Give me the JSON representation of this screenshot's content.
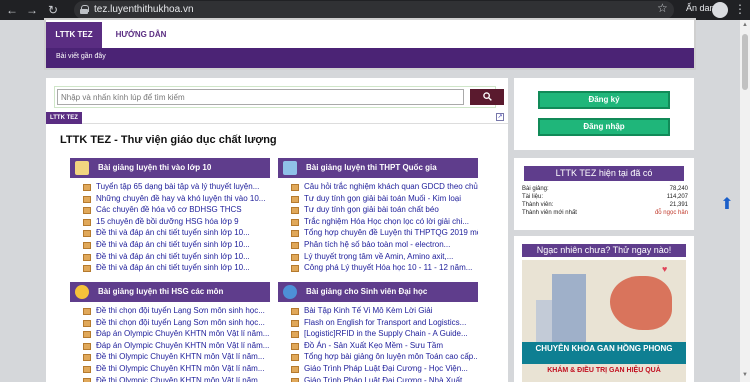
{
  "browser": {
    "url": "tez.luyenthithukhoa.vn",
    "profile_label": "Ẩn danh",
    "icons": [
      "back-icon",
      "forward-icon",
      "reload-icon",
      "lock-icon",
      "star-icon",
      "incognito-icon",
      "menu-icon"
    ]
  },
  "header": {
    "tabs": [
      "LTTK TEZ",
      "HƯỚNG DẪN"
    ],
    "subnav_link": "Bài viết gần đây"
  },
  "search": {
    "placeholder": "Nhập và nhấn kính lúp để tìm kiếm"
  },
  "breadcrumb": "LTTK TEZ",
  "page_title": "LTTK TEZ - Thư viện giáo dục chất lượng",
  "panels": [
    {
      "title": "Bài giảng luyện thi vào lớp 10",
      "items": [
        "Tuyển tập 65 dạng bài tập và lý thuyết luyện...",
        "Những chuyên đề hay và khó luyện thi vào 10...",
        "Các chuyên đề hóa vô cơ BDHSG THCS",
        "15 chuyên đề bồi dưỡng HSG hóa lớp 9",
        "Đề thi và đáp án chi tiết tuyển sinh lớp 10...",
        "Đề thi và đáp án chi tiết tuyển sinh lớp 10...",
        "Đề thi và đáp án chi tiết tuyển sinh lớp 10...",
        "Đề thi và đáp án chi tiết tuyển sinh lớp 10..."
      ]
    },
    {
      "title": "Bài giảng luyện thi THPT Quốc gia",
      "items": [
        "Câu hỏi trắc nghiệm khách quan GDCD theo chủ...",
        "Tư duy tính gọn giải bài toán Muối - Kim loại",
        "Tư duy tính gọn giải bài toán chất béo",
        "Trắc nghiệm Hóa Học chọn lọc có lời giải chi...",
        "Tổng hợp chuyên đề Luyện thi THPTQG 2019 môn...",
        "Phân tích hệ số bảo toàn mol - electron...",
        "Lý thuyết trọng tâm về Amin, Amino axit,...",
        "Công phá Lý thuyết Hóa học 10 - 11 - 12 năm..."
      ]
    },
    {
      "title": "Bài giảng luyện thi HSG các môn",
      "items": [
        "Đề thi chọn đội tuyển Lạng Sơn môn sinh học...",
        "Đề thi chọn đội tuyển Lạng Sơn môn sinh học...",
        "Đáp án Olympic Chuyên KHTN môn Vật lí năm...",
        "Đáp án Olympic Chuyên KHTN môn Vật lí năm...",
        "Đề thi Olympic Chuyên KHTN môn Vật lí năm...",
        "Đề thi Olympic Chuyên KHTN môn Vật lí năm...",
        "Đề thi Olympic Chuyên KHTN môn Vật lí năm...",
        "Đề thi Olympic Chuyên KHTN môn Vật lí năm..."
      ]
    },
    {
      "title": "Bài giảng cho Sinh viên Đại học",
      "items": [
        "Bài Tập Kinh Tế Vi Mô Kèm Lời Giải",
        "Flash on English for Transport and Logistics...",
        "[Logistic]RFID in the Supply Chain - A Guide...",
        "Đồ Án - Sản Xuất Kẹo Mềm - Sưu Tầm",
        "Tổng hợp bài giảng ôn luyện môn Toán cao cấp...",
        "Giáo Trình Pháp Luật Đại Cương - Học Viện...",
        "Giáo Trình Pháp Luật Đại Cương - Nhà Xuất..."
      ]
    }
  ],
  "sidebar": {
    "register": "Đăng ký",
    "login": "Đăng nhập",
    "stats_title": "LTTK TEZ hiện tại đã có",
    "stats": [
      {
        "label": "Bài giảng:",
        "value": "78,240"
      },
      {
        "label": "Tài liệu:",
        "value": "114,207"
      },
      {
        "label": "Thành viên:",
        "value": "21,391"
      },
      {
        "label": "Thành viên mới nhất",
        "value": "đỗ ngọc hân"
      }
    ],
    "promo_title": "Ngạc nhiên chưa? Thử ngay nào!",
    "ad_line1": "CHUYÊN KHOA GAN HỒNG PHONG",
    "ad_line2": "KHÁM & ĐIỀU TRỊ GAN HIỆU QUẢ",
    "stat_value_color_new": "#c0392b"
  }
}
